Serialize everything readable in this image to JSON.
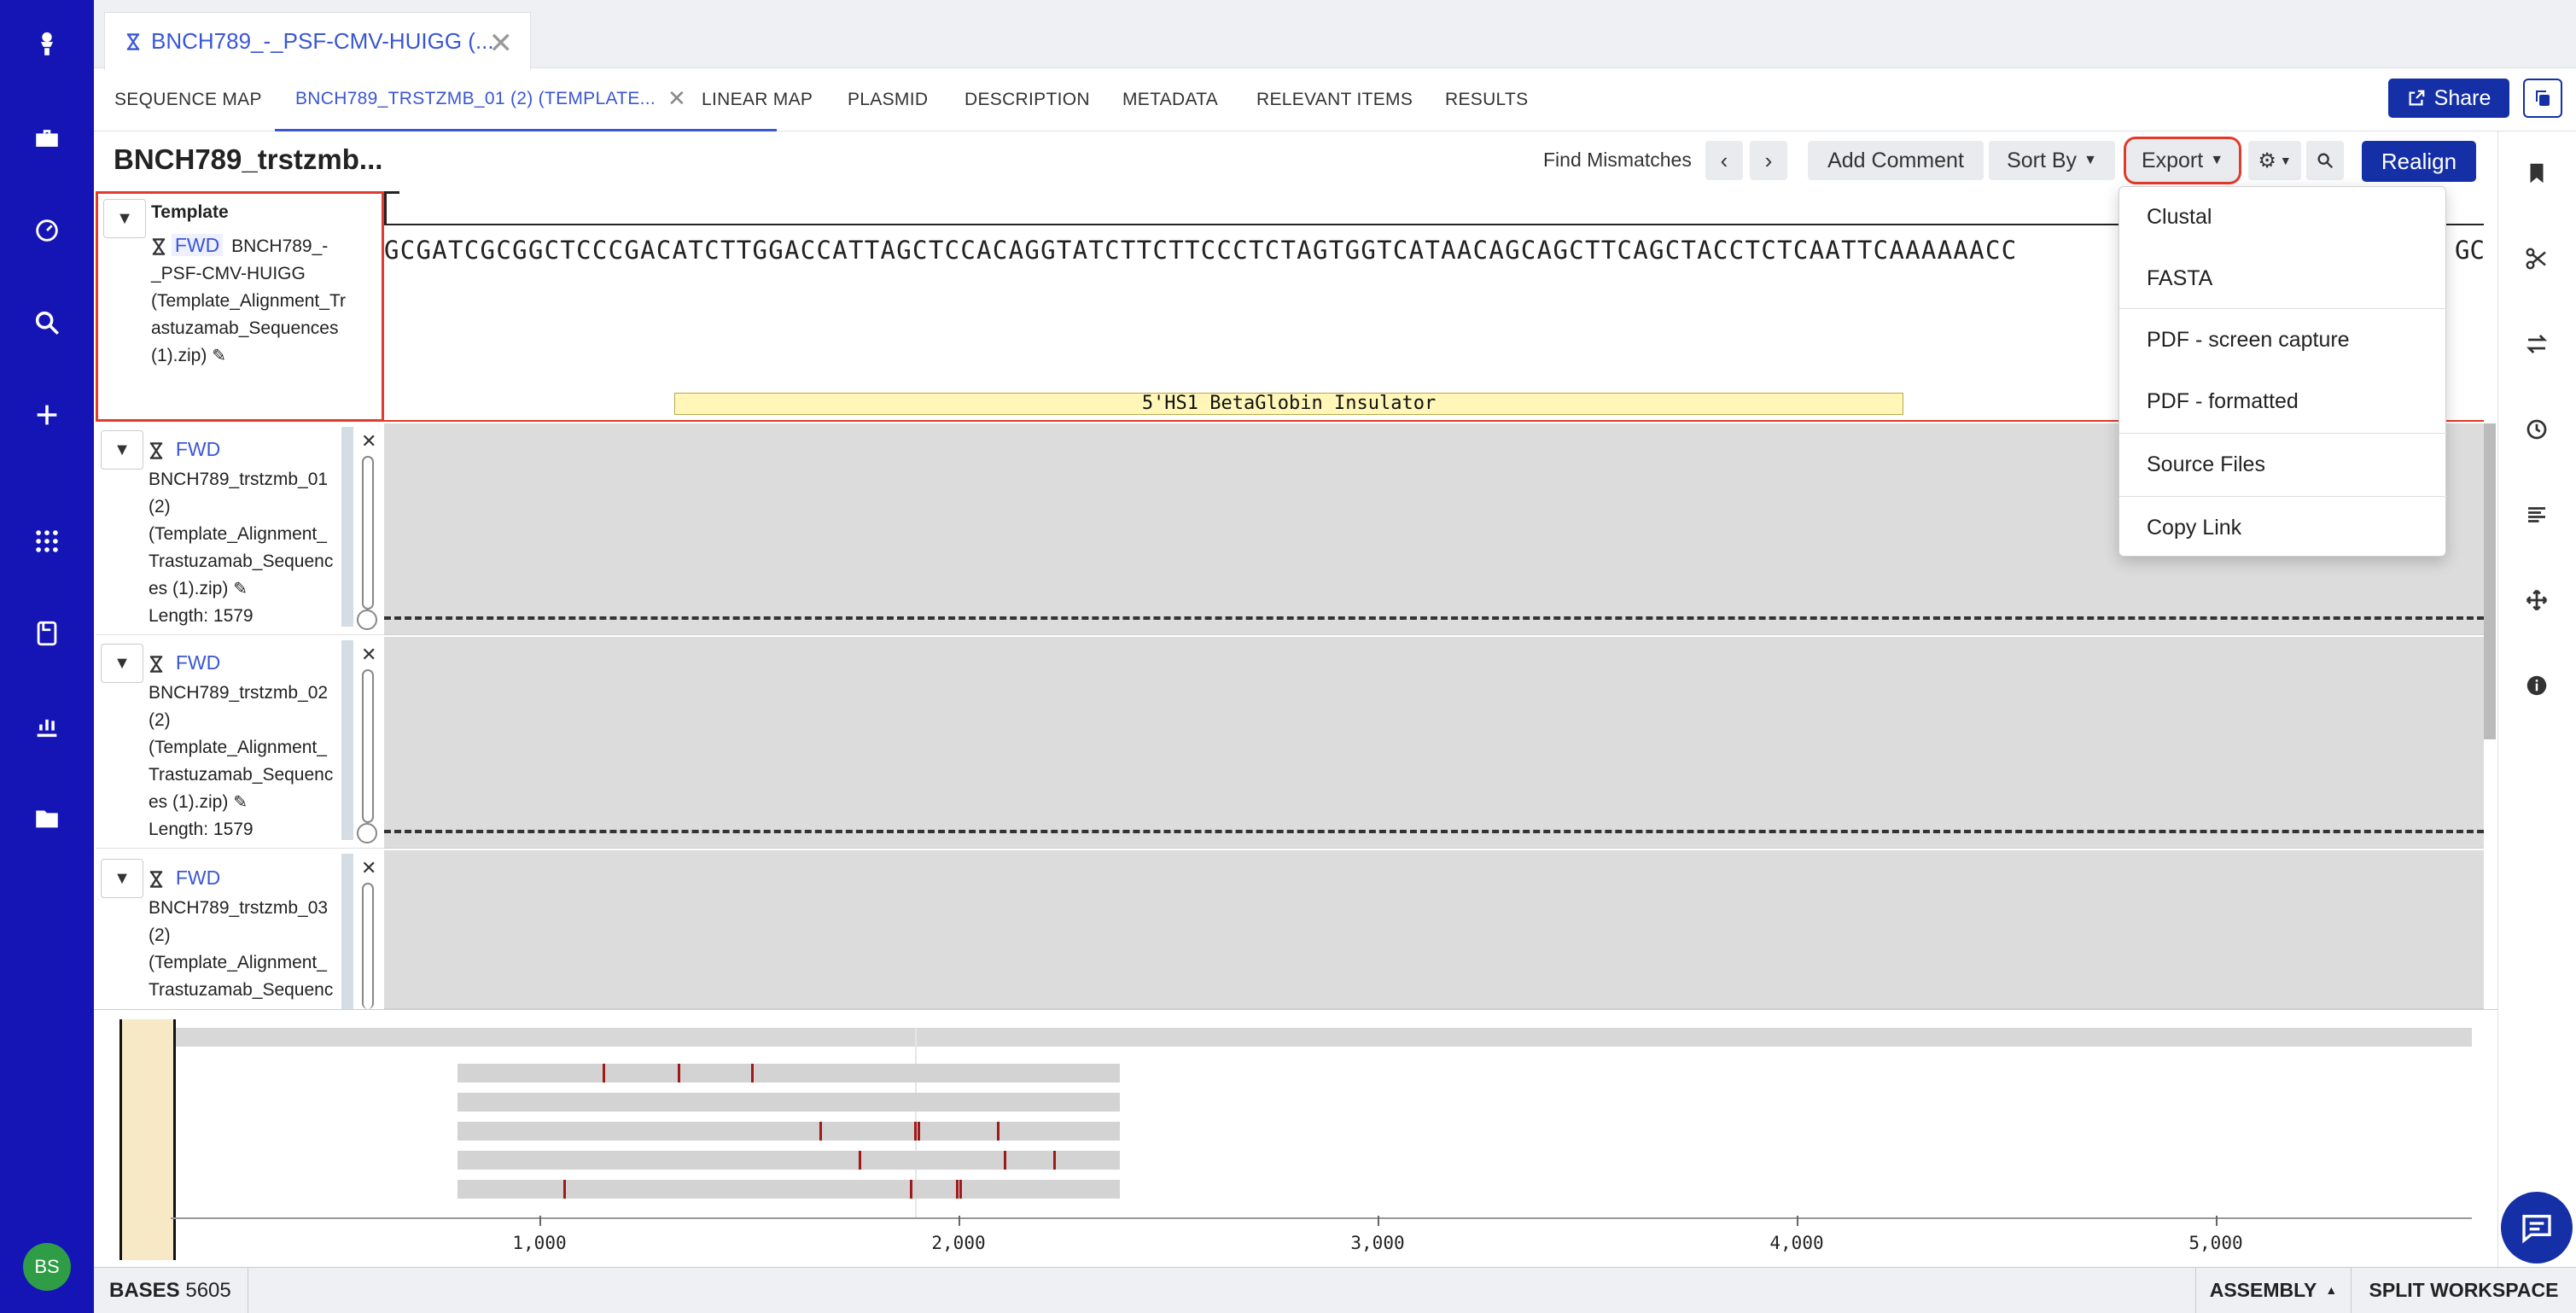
{
  "doc_tab": {
    "title": "BNCH789_-_PSF-CMV-HUIGG (..."
  },
  "subtabs": [
    "SEQUENCE MAP",
    "BNCH789_TRSTZMB_01 (2) (TEMPLATE...",
    "LINEAR MAP",
    "PLASMID",
    "DESCRIPTION",
    "METADATA",
    "RELEVANT ITEMS",
    "RESULTS"
  ],
  "header": {
    "share_label": "Share"
  },
  "toolbar": {
    "title": "BNCH789_trstzmb...",
    "find_mismatches": "Find Mismatches",
    "add_comment": "Add Comment",
    "sort_by": "Sort By",
    "export": "Export",
    "realign": "Realign"
  },
  "export_menu": [
    "Clustal",
    "FASTA",
    "PDF - screen capture",
    "PDF - formatted",
    "Source Files",
    "Copy Link"
  ],
  "template": {
    "heading": "Template",
    "direction": "FWD",
    "name_lines": [
      "BNCH789_-",
      "_PSF-CMV-HUIGG",
      "(Template_Alignment_Tr",
      "astuzamab_Sequences",
      "(1).zip)"
    ],
    "sequence": "GCGATCGCGGCTCCCGACATCTTGGACCATTAGCTCCACAGGTATCTTCTTCCCTCTAGTGGTCATAACAGCAGCTTCAGCTACCTCTCAATTCAAAAAACC",
    "sequence_tail": "GC",
    "feature": "5'HS1 BetaGlobin Insulator"
  },
  "reads": [
    {
      "direction": "FWD",
      "name_lines": [
        "BNCH789_trstzmb_01",
        "(2)",
        "(Template_Alignment_",
        "Trastuzamab_Sequenc",
        "es (1).zip)"
      ],
      "length": "Length: 1579"
    },
    {
      "direction": "FWD",
      "name_lines": [
        "BNCH789_trstzmb_02",
        "(2)",
        "(Template_Alignment_",
        "Trastuzamab_Sequenc",
        "es (1).zip)"
      ],
      "length": "Length: 1579"
    },
    {
      "direction": "FWD",
      "name_lines": [
        "BNCH789_trstzmb_03",
        "(2)",
        "(Template_Alignment_",
        "Trastuzamab_Sequenc"
      ],
      "length": ""
    }
  ],
  "overview": {
    "ticks": [
      "1,000",
      "2,000",
      "3,000",
      "4,000",
      "5,000"
    ]
  },
  "status": {
    "bases_label": "BASES",
    "bases_value": "5605",
    "assembly": "ASSEMBLY",
    "split": "SPLIT WORKSPACE"
  },
  "user": {
    "initials": "BS"
  },
  "colors": {
    "rail": "#1515b5",
    "primary": "#1530a6",
    "accent_link": "#3a56d4",
    "highlight": "#e23b2b",
    "mismatch": "#a01a1a",
    "feature": "#fff6b8"
  }
}
